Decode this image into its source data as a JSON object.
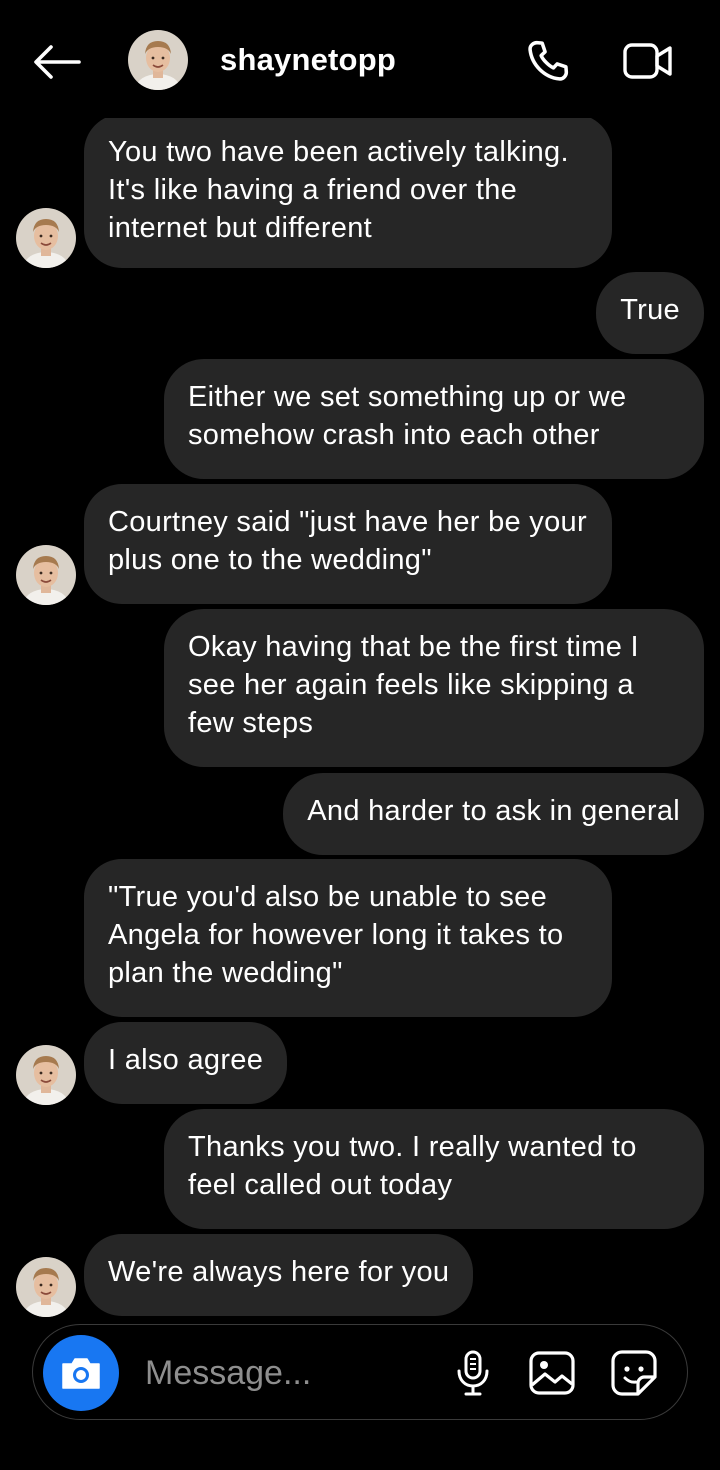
{
  "header": {
    "username": "shaynetopp",
    "icons": {
      "back": "arrow-left-icon",
      "call": "phone-icon",
      "video": "video-camera-icon"
    }
  },
  "messages": [
    {
      "from": "them",
      "text": "You two have been actively talking. It's like having a friend over the internet but different"
    },
    {
      "from": "me",
      "text": "True"
    },
    {
      "from": "me",
      "text": "Either we set something up or we somehow crash into each other"
    },
    {
      "from": "them",
      "text": "Courtney said \"just have her be your plus one to the wedding\""
    },
    {
      "from": "me",
      "text": "Okay having that be the first time I see her again feels like skipping a few steps"
    },
    {
      "from": "me",
      "text": "And harder to ask in general"
    },
    {
      "from": "them",
      "text": "\"True you'd also be unable to see Angela for however long it takes to plan the wedding\""
    },
    {
      "from": "them",
      "text": "I also agree"
    },
    {
      "from": "me",
      "text": "Thanks you two. I really wanted to feel called out today"
    },
    {
      "from": "them",
      "text": "We're always here for you"
    }
  ],
  "composer": {
    "placeholder": "Message...",
    "icons": {
      "camera": "camera-icon",
      "mic": "microphone-icon",
      "gallery": "image-icon",
      "sticker": "sticker-icon"
    }
  },
  "colors": {
    "background": "#000000",
    "bubble": "#262626",
    "accent": "#1877f2",
    "placeholder": "#8e8e8e"
  }
}
